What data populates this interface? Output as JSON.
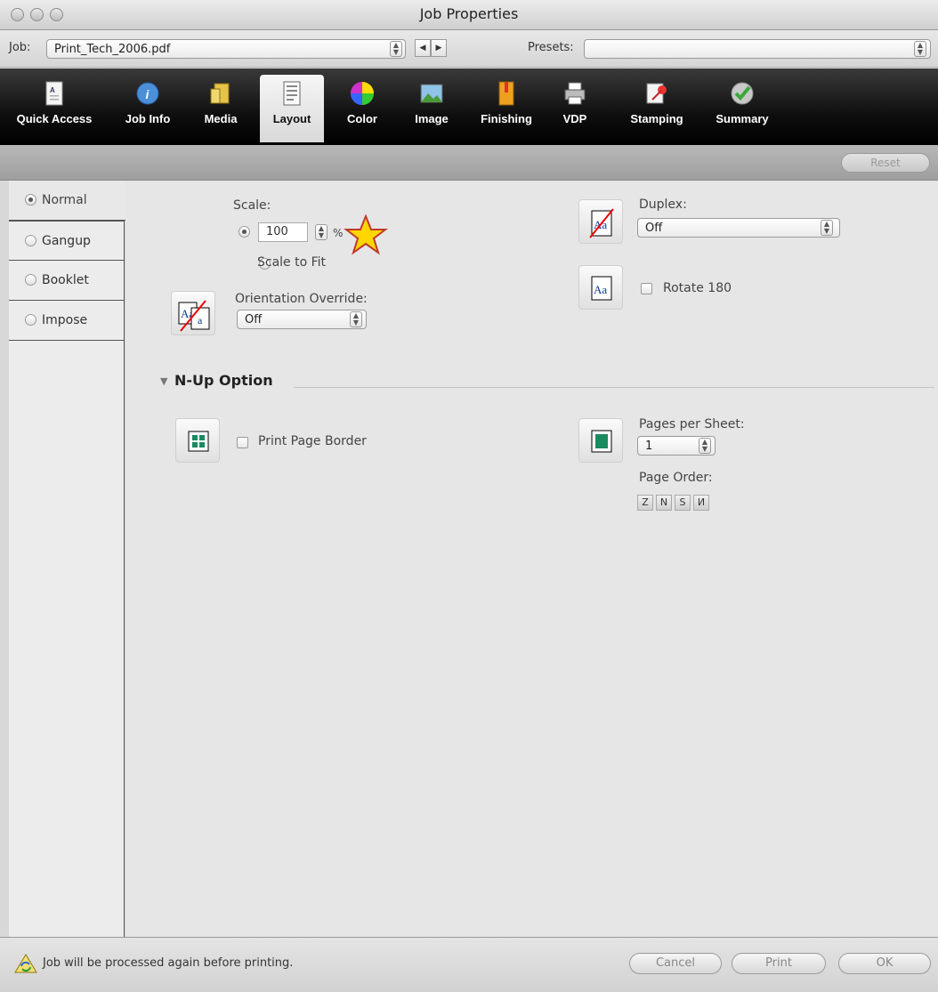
{
  "window": {
    "title": "Job Properties"
  },
  "jobrow": {
    "job_label": "Job:",
    "job_value": "Print_Tech_2006.pdf",
    "presets_label": "Presets:",
    "presets_value": ""
  },
  "toolbar": {
    "tabs": [
      {
        "label": "Quick Access",
        "icon": "quick-access-icon"
      },
      {
        "label": "Job Info",
        "icon": "info-icon"
      },
      {
        "label": "Media",
        "icon": "media-icon"
      },
      {
        "label": "Layout",
        "icon": "layout-icon",
        "active": true
      },
      {
        "label": "Color",
        "icon": "color-wheel-icon"
      },
      {
        "label": "Image",
        "icon": "image-icon"
      },
      {
        "label": "Finishing",
        "icon": "finishing-icon"
      },
      {
        "label": "VDP",
        "icon": "printer-icon"
      },
      {
        "label": "Stamping",
        "icon": "stamping-icon"
      },
      {
        "label": "Summary",
        "icon": "checkmark-icon"
      }
    ]
  },
  "strip": {
    "reset_label": "Reset"
  },
  "sidebar": {
    "items": [
      {
        "label": "Normal",
        "selected": true
      },
      {
        "label": "Gangup",
        "selected": false
      },
      {
        "label": "Booklet",
        "selected": false
      },
      {
        "label": "Impose",
        "selected": false
      }
    ]
  },
  "layout": {
    "scale_label": "Scale:",
    "scale_value": "100",
    "scale_unit": "%",
    "scale_to_fit_label": "Scale to Fit",
    "orientation_label": "Orientation Override:",
    "orientation_value": "Off",
    "duplex_label": "Duplex:",
    "duplex_value": "Off",
    "rotate_label": "Rotate 180"
  },
  "nup": {
    "section_label": "N-Up Option",
    "print_border_label": "Print Page Border",
    "pages_per_sheet_label": "Pages per Sheet:",
    "pages_per_sheet_value": "1",
    "page_order_label": "Page Order:",
    "page_order_glyphs": [
      "Z",
      "N",
      "S",
      "И"
    ]
  },
  "footer": {
    "message": "Job will be processed again before printing.",
    "cancel_label": "Cancel",
    "print_label": "Print",
    "ok_label": "OK"
  },
  "colors": {
    "accent_star": "#ffd600",
    "toolbar_bg": "#000000"
  }
}
